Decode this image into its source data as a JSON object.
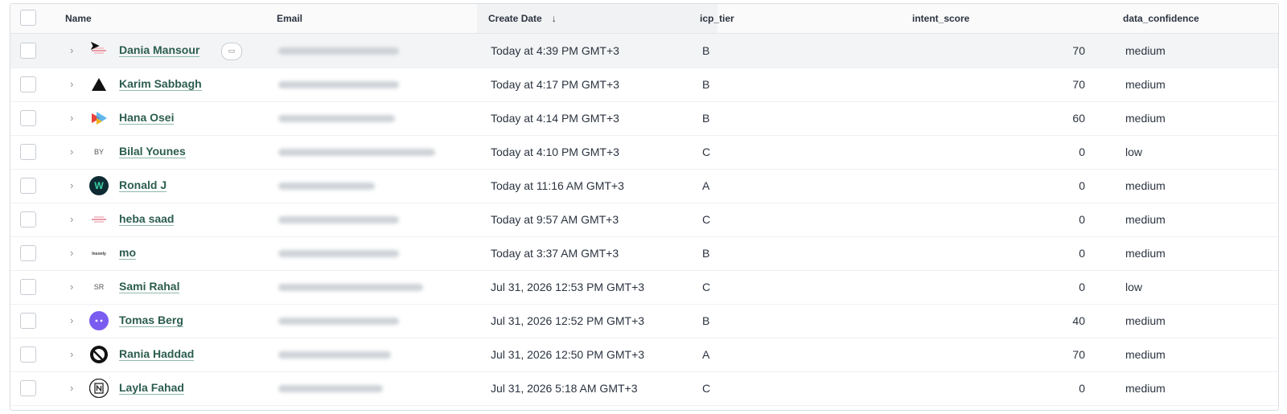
{
  "columns": {
    "name": "Name",
    "email": "Email",
    "create_date": "Create Date",
    "create_date_sort": "↓",
    "icp_tier": "icp_tier",
    "intent_score": "intent_score",
    "data_confidence": "data_confidence"
  },
  "rows": [
    {
      "name": "Dania Mansour",
      "logo_text": "",
      "icon": "company-logo-icon",
      "date": "Today at 4:39 PM GMT+3",
      "tier": "B",
      "score": "70",
      "confidence": "medium"
    },
    {
      "name": "Karim Sabbagh",
      "logo_text": "",
      "icon": "triangle-logo-icon",
      "date": "Today at 4:17 PM GMT+3",
      "tier": "B",
      "score": "70",
      "confidence": "medium"
    },
    {
      "name": "Hana Osei",
      "logo_text": "",
      "icon": "play-logo-icon",
      "date": "Today at 4:14 PM GMT+3",
      "tier": "B",
      "score": "60",
      "confidence": "medium"
    },
    {
      "name": "Bilal Younes",
      "logo_text": "BY",
      "icon": "initials-avatar",
      "date": "Today at 4:10 PM GMT+3",
      "tier": "C",
      "score": "0",
      "confidence": "low"
    },
    {
      "name": "Ronald J",
      "logo_text": "W",
      "icon": "w-logo-icon",
      "date": "Today at 11:16 AM GMT+3",
      "tier": "A",
      "score": "0",
      "confidence": "medium"
    },
    {
      "name": "heba saad",
      "logo_text": "",
      "icon": "company-logo-icon",
      "date": "Today at 9:57 AM GMT+3",
      "tier": "C",
      "score": "0",
      "confidence": "medium"
    },
    {
      "name": "mo",
      "logo_text": "",
      "icon": "wordmark-logo-icon",
      "date": "Today at 3:37 AM GMT+3",
      "tier": "B",
      "score": "0",
      "confidence": "medium"
    },
    {
      "name": "Sami Rahal",
      "logo_text": "SR",
      "icon": "initials-avatar",
      "date": "Jul 31, 2026 12:53 PM GMT+3",
      "tier": "C",
      "score": "0",
      "confidence": "low"
    },
    {
      "name": "Tomas Berg",
      "logo_text": "",
      "icon": "purple-circle-logo-icon",
      "date": "Jul 31, 2026 12:52 PM GMT+3",
      "tier": "B",
      "score": "40",
      "confidence": "medium"
    },
    {
      "name": "Rania Haddad",
      "logo_text": "",
      "icon": "striped-circle-logo-icon",
      "date": "Jul 31, 2026 12:50 PM GMT+3",
      "tier": "A",
      "score": "70",
      "confidence": "medium"
    },
    {
      "name": "Layla Fahad",
      "logo_text": "N",
      "icon": "notion-logo-icon",
      "date": "Jul 31, 2026 5:18 AM GMT+3",
      "tier": "C",
      "score": "0",
      "confidence": "medium"
    }
  ],
  "colors": {
    "link": "#2c5d4f",
    "hover_row": "#f3f4f5",
    "header_bg": "#fafafa"
  }
}
